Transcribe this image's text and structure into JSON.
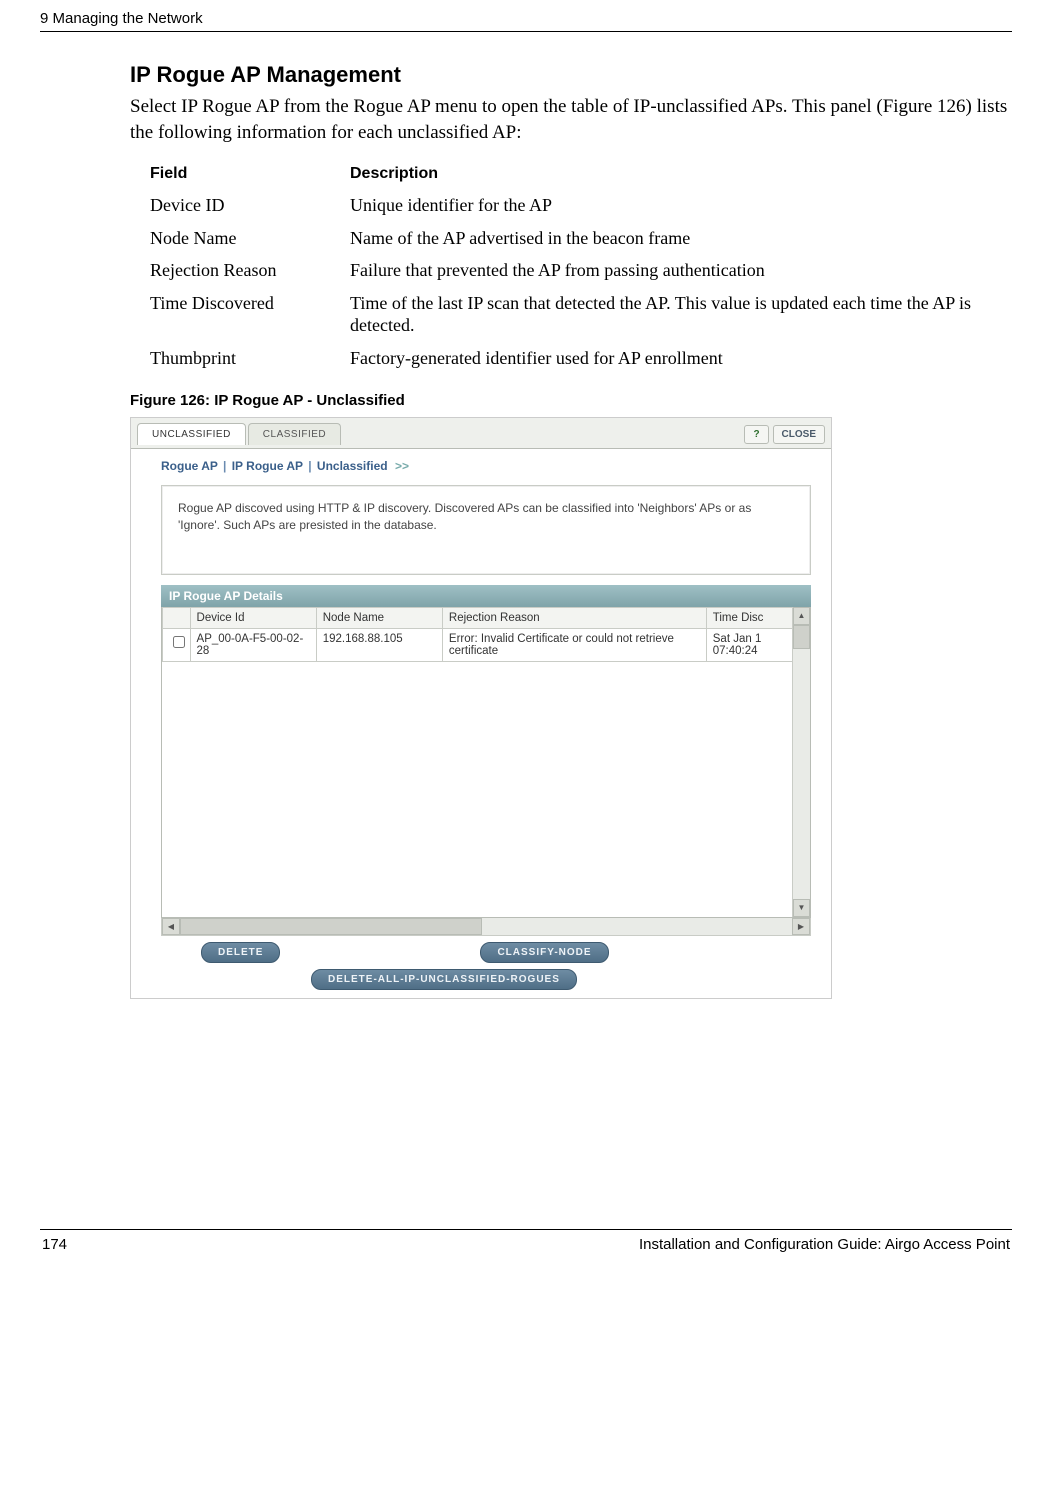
{
  "header": {
    "chapter": "9  Managing the Network"
  },
  "section": {
    "title": "IP Rogue AP Management",
    "body": "Select IP Rogue AP from the Rogue AP menu to open the table of IP-unclassified APs. This panel (Figure 126) lists the following information for each unclassified AP:"
  },
  "fields_table": {
    "head": {
      "field": "Field",
      "desc": "Description"
    },
    "rows": [
      {
        "field": "Device ID",
        "desc": "Unique identifier for the AP"
      },
      {
        "field": "Node Name",
        "desc": "Name of the AP advertised in the beacon frame"
      },
      {
        "field": "Rejection Reason",
        "desc": "Failure that prevented the AP from passing authentication"
      },
      {
        "field": "Time Discovered",
        "desc": "Time of the last IP scan that detected the AP. This value is updated each time the AP is detected."
      },
      {
        "field": "Thumbprint",
        "desc": "Factory-generated identifier used for AP enrollment"
      }
    ]
  },
  "figure": {
    "caption": "Figure 126:    IP Rogue AP - Unclassified"
  },
  "screenshot": {
    "tabs": {
      "active": "UNCLASSIFIED",
      "inactive": "CLASSIFIED"
    },
    "help": "?",
    "close": "CLOSE",
    "breadcrumb": {
      "a": "Rogue AP",
      "b": "IP Rogue AP",
      "c": "Unclassified",
      "sep": "|",
      "more": ">>"
    },
    "explain": "Rogue AP discoved using HTTP & IP discovery. Discovered APs can be classified into 'Neighbors' APs or as 'Ignore'. Such APs are presisted in the database.",
    "details_title": "IP Rogue AP Details",
    "grid": {
      "headers": {
        "device": "Device Id",
        "node": "Node Name",
        "rej": "Rejection Reason",
        "time": "Time Disc"
      },
      "rows": [
        {
          "device": "AP_00-0A-F5-00-02-28",
          "node": "192.168.88.105",
          "rej": "Error: Invalid Certificate or could not retrieve certificate",
          "time": "Sat Jan 1 07:40:24"
        }
      ]
    },
    "buttons": {
      "delete": "DELETE",
      "classify": "CLASSIFY-NODE",
      "delete_all": "DELETE-ALL-IP-UNCLASSIFIED-ROGUES"
    }
  },
  "footer": {
    "page": "174",
    "title": "Installation and Configuration Guide: Airgo Access Point"
  }
}
